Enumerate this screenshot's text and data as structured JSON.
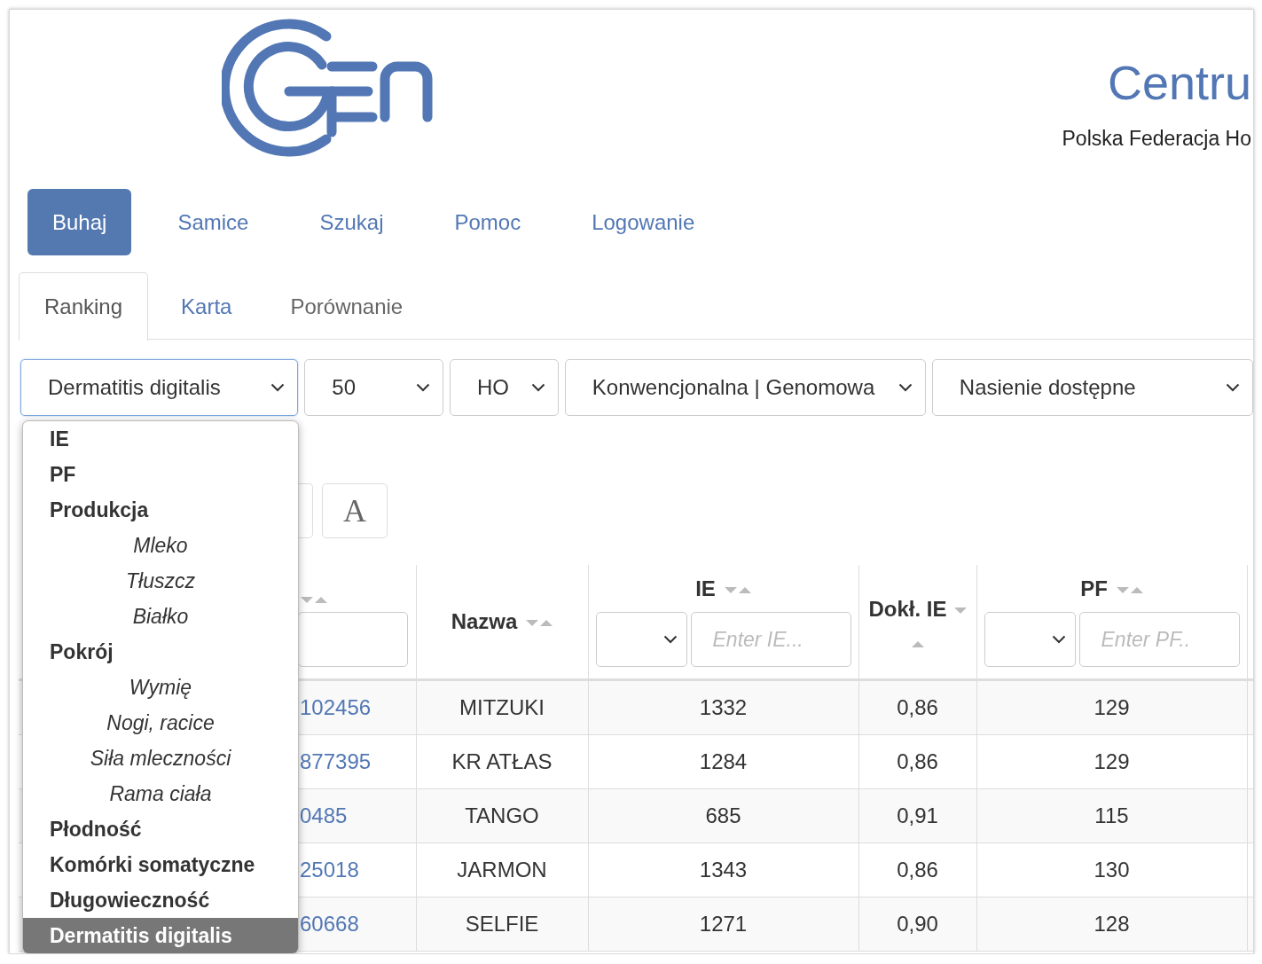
{
  "header": {
    "title": "Centru",
    "subtitle": "Polska Federacja Ho"
  },
  "nav": [
    {
      "label": "Buhaj",
      "selected": true
    },
    {
      "label": "Samice",
      "selected": false
    },
    {
      "label": "Szukaj",
      "selected": false
    },
    {
      "label": "Pomoc",
      "selected": false
    },
    {
      "label": "Logowanie",
      "selected": false
    }
  ],
  "tabs": [
    {
      "label": "Ranking",
      "selected": true,
      "disabled": false
    },
    {
      "label": "Karta",
      "selected": false,
      "disabled": false
    },
    {
      "label": "Porównanie",
      "selected": false,
      "disabled": true
    }
  ],
  "filters": [
    {
      "value": "Dermatitis digitalis",
      "focused": true
    },
    {
      "value": "50",
      "focused": false
    },
    {
      "value": "HO",
      "focused": false
    },
    {
      "value": "Konwencjonalna | Genomowa",
      "focused": false
    },
    {
      "value": "Nasienie dostępne",
      "focused": false
    }
  ],
  "trait_menu": [
    {
      "label": "IE",
      "kind": "group",
      "selected": false
    },
    {
      "label": "PF",
      "kind": "group",
      "selected": false
    },
    {
      "label": "Produkcja",
      "kind": "group",
      "selected": false
    },
    {
      "label": "Mleko",
      "kind": "sub",
      "selected": false
    },
    {
      "label": "Tłuszcz",
      "kind": "sub",
      "selected": false
    },
    {
      "label": "Białko",
      "kind": "sub",
      "selected": false
    },
    {
      "label": "Pokrój",
      "kind": "group",
      "selected": false
    },
    {
      "label": "Wymię",
      "kind": "sub",
      "selected": false
    },
    {
      "label": "Nogi, racice",
      "kind": "sub",
      "selected": false
    },
    {
      "label": "Siła mleczności",
      "kind": "sub",
      "selected": false
    },
    {
      "label": "Rama ciała",
      "kind": "sub",
      "selected": false
    },
    {
      "label": "Płodność",
      "kind": "group",
      "selected": false
    },
    {
      "label": "Komórki somatyczne",
      "kind": "group",
      "selected": false
    },
    {
      "label": "Długowieczność",
      "kind": "group",
      "selected": false
    },
    {
      "label": "Dermatitis digitalis",
      "kind": "group",
      "selected": true
    }
  ],
  "toolbar": {
    "font_button": "A"
  },
  "table": {
    "columns": [
      {
        "kind": "input"
      },
      {
        "label": "Nazwa",
        "kind": "plain"
      },
      {
        "label": "IE",
        "kind": "range",
        "placeholder": "Enter IE..."
      },
      {
        "label": "Dokł. IE",
        "kind": "narrow"
      },
      {
        "label": "PF",
        "kind": "range",
        "placeholder": "Enter PF.."
      }
    ],
    "rows": [
      [
        "102456",
        "MITZUKI",
        "1332",
        "0,86",
        "129"
      ],
      [
        "877395",
        "KR ATŁAS",
        "1284",
        "0,86",
        "129"
      ],
      [
        "0485",
        "TANGO",
        "685",
        "0,91",
        "115"
      ],
      [
        "25018",
        "JARMON",
        "1343",
        "0,86",
        "130"
      ],
      [
        "60668",
        "SELFIE",
        "1271",
        "0,90",
        "128"
      ]
    ]
  }
}
